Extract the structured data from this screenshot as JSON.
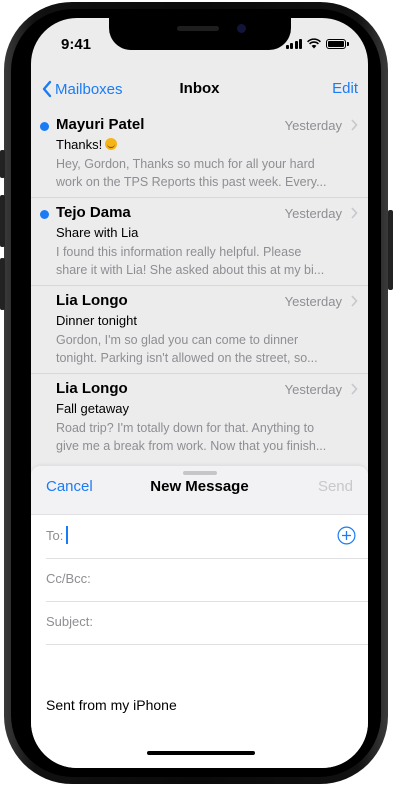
{
  "status_bar": {
    "time": "9:41"
  },
  "nav": {
    "back_label": "Mailboxes",
    "title": "Inbox",
    "edit_label": "Edit"
  },
  "messages": [
    {
      "sender": "Mayuri Patel",
      "date": "Yesterday",
      "subject": "Thanks!",
      "has_emoji": true,
      "unread": true,
      "preview_line1": "Hey, Gordon, Thanks so much for all your hard",
      "preview_line2": "work on the TPS Reports this past week. Every..."
    },
    {
      "sender": "Tejo Dama",
      "date": "Yesterday",
      "subject": "Share with Lia",
      "unread": true,
      "preview_line1": "I found this information really helpful. Please",
      "preview_line2": "share it with Lia! She asked about this at my bi..."
    },
    {
      "sender": "Lia Longo",
      "date": "Yesterday",
      "subject": "Dinner tonight",
      "unread": false,
      "preview_line1": "Gordon, I'm so glad you can come to dinner",
      "preview_line2": "tonight. Parking isn't allowed on the street, so..."
    },
    {
      "sender": "Lia Longo",
      "date": "Yesterday",
      "subject": "Fall getaway",
      "unread": false,
      "preview_line1": "Road trip? I'm totally down for that. Anything to",
      "preview_line2": "give me a break from work. Now that you finish..."
    }
  ],
  "compose": {
    "cancel_label": "Cancel",
    "title": "New Message",
    "send_label": "Send",
    "to_label": "To:",
    "to_value": "",
    "ccbcc_label": "Cc/Bcc:",
    "subject_label": "Subject:",
    "signature": "Sent from my iPhone"
  },
  "colors": {
    "accent": "#1a7cf5",
    "unread_dot": "#1a7cf5",
    "secondary_text": "#8e8e93",
    "disabled": "#c7c7cc"
  }
}
